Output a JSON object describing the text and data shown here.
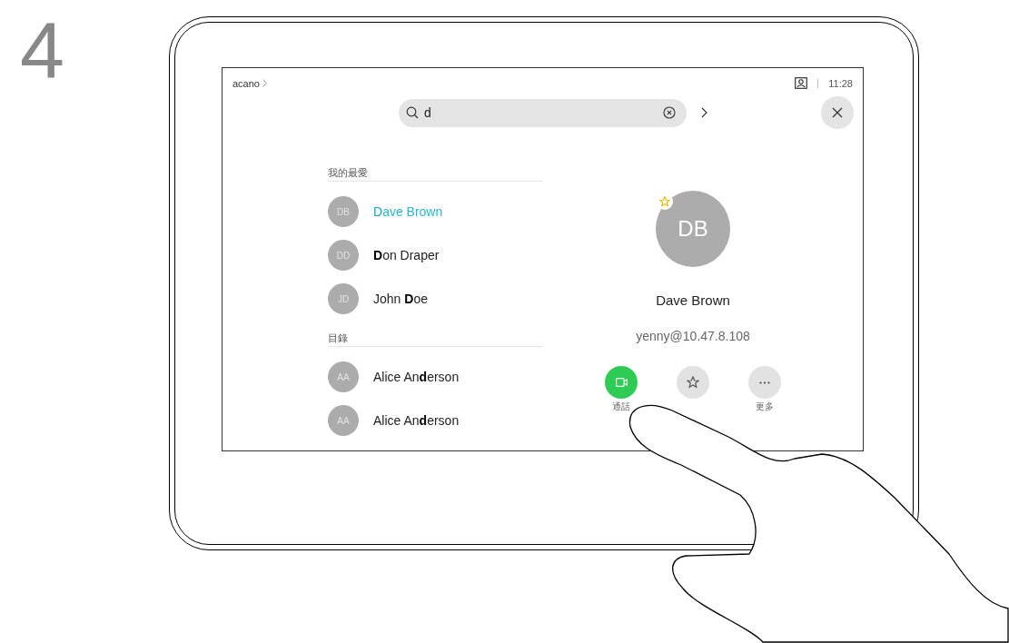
{
  "step": "4",
  "top_bar": {
    "breadcrumb": "acano",
    "time": "11:28"
  },
  "search": {
    "value": "d"
  },
  "sections": [
    {
      "heading": "我的最愛",
      "contacts": [
        {
          "initials": "DB",
          "name": "**D**ave Brown",
          "selected": true
        },
        {
          "initials": "DD",
          "name": "**D**on Draper",
          "selected": false
        },
        {
          "initials": "JD",
          "name": "John **D**oe",
          "selected": false
        }
      ]
    },
    {
      "heading": "目錄",
      "contacts": [
        {
          "initials": "AA",
          "name": "Alice An**d**erson",
          "selected": false
        },
        {
          "initials": "AA",
          "name": "Alice An**d**erson",
          "selected": false
        }
      ]
    }
  ],
  "detail": {
    "initials": "DB",
    "favorite": true,
    "name": "Dave Brown",
    "address": "yenny@10.47.8.108",
    "actions": [
      {
        "kind": "call",
        "label": "通話"
      },
      {
        "kind": "favorite"
      },
      {
        "kind": "more",
        "label": "更多"
      }
    ]
  }
}
